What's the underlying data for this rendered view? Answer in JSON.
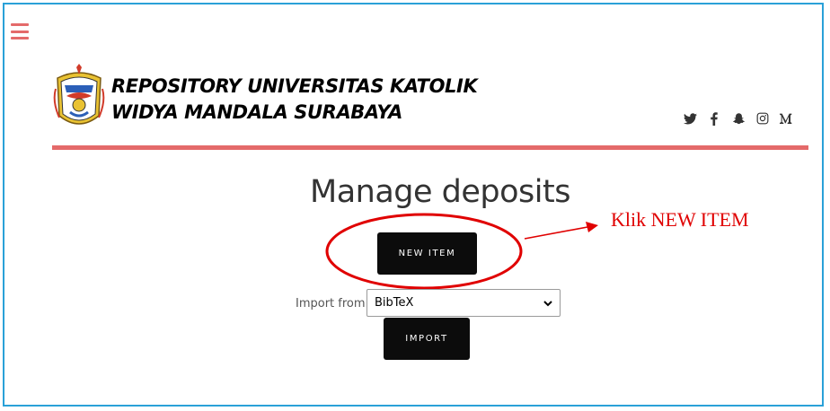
{
  "header": {
    "title_line1": "REPOSITORY UNIVERSITAS KATOLIK",
    "title_line2": "WIDYA MANDALA SURABAYA",
    "social_icons": [
      "twitter-icon",
      "facebook-icon",
      "snapchat-icon",
      "instagram-icon",
      "medium-icon"
    ]
  },
  "main": {
    "title": "Manage deposits",
    "new_item_label": "NEW ITEM",
    "import_label": "Import from",
    "import_select_value": "BibTeX",
    "import_button_label": "IMPORT"
  },
  "annotation": {
    "text": "Klik NEW ITEM",
    "color": "#e00000"
  },
  "colors": {
    "accent": "#e46a6a",
    "frame": "#2aa1d8",
    "button": "#0c0c0c"
  }
}
